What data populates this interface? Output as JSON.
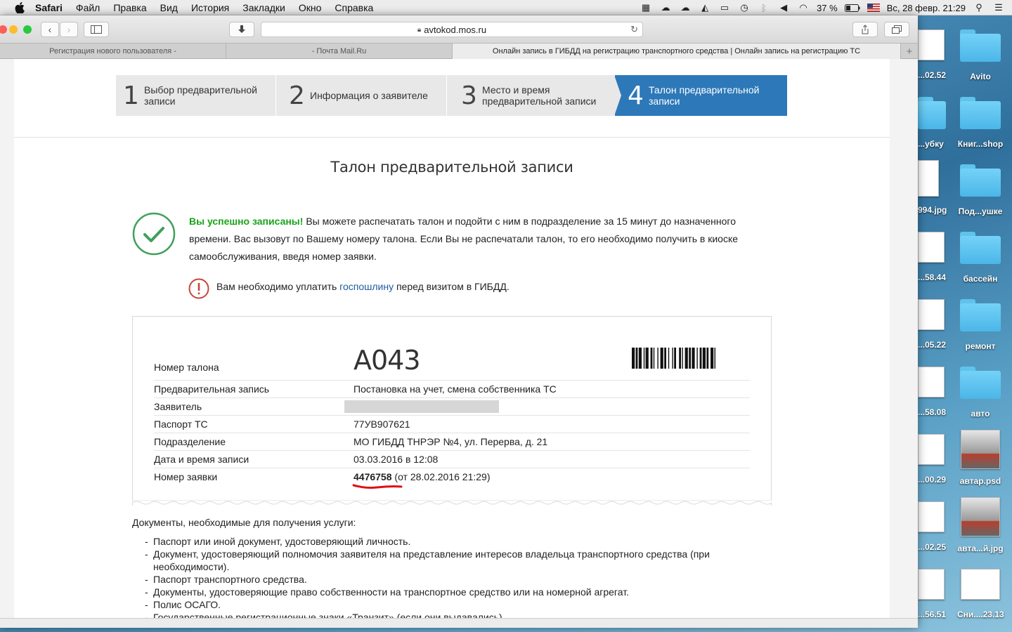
{
  "menubar": {
    "items": [
      "Safari",
      "Файл",
      "Правка",
      "Вид",
      "История",
      "Закладки",
      "Окно",
      "Справка"
    ],
    "battery": "37 %",
    "datetime": "Вс, 28 февр.  21:29"
  },
  "browser": {
    "url": "avtokod.mos.ru",
    "tabs": [
      "Регистрация нового пользователя -",
      "- Почта Mail.Ru",
      "Онлайн запись в ГИБДД на регистрацию транспортного средства | Онлайн запись на регистрацию ТС"
    ]
  },
  "steps": [
    {
      "num": "1",
      "label": "Выбор предварительной записи"
    },
    {
      "num": "2",
      "label": "Информация о заявителе"
    },
    {
      "num": "3",
      "label": "Место и время предварительной записи"
    },
    {
      "num": "4",
      "label": "Талон предварительной записи"
    }
  ],
  "page": {
    "title": "Талон предварительной записи",
    "success_strong": "Вы успешно записаны!",
    "success_text": " Вы можете распечатать талон и подойти с ним в подразделение за 15 минут до назначенного времени. Вас вызовут по Вашему номеру талона. Если Вы не распечатали талон, то его необходимо получить в киоске самообслуживания, введя номер заявки.",
    "warn_before": "Вам необходимо уплатить ",
    "warn_link": "госпошлину",
    "warn_after": " перед визитом в ГИБДД."
  },
  "ticket": {
    "number_label": "Номер талона",
    "number": "А043",
    "rows": [
      {
        "key": "Предварительная запись",
        "value": "Постановка на учет, смена собственника ТС"
      },
      {
        "key": "Заявитель",
        "value": ""
      },
      {
        "key": "Паспорт ТС",
        "value": "77УВ907621"
      },
      {
        "key": "Подразделение",
        "value": "МО ГИБДД ТНРЭР №4, ул. Перерва, д. 21"
      },
      {
        "key": "Дата и время записи",
        "value": "03.03.2016 в 12:08"
      }
    ],
    "request_label": "Номер заявки",
    "request_number": "4476758",
    "request_date": " (от 28.02.2016 21:29)"
  },
  "documents": {
    "title": "Документы, необходимые для получения услуги:",
    "items": [
      "Паспорт или иной документ, удостоверяющий личность.",
      "Документ, удостоверяющий полномочия заявителя на представление интересов владельца транспортного средства (при необходимости).",
      "Паспорт транспортного средства.",
      "Документы, удостоверяющие право собственности на транспортное средство или на номерной агрегат.",
      "Полис ОСАГО.",
      "Государственные регистрационные знаки «Транзит» (если они выдавались)."
    ]
  },
  "desktop": {
    "left_labels": [
      "...02.52",
      "...убку",
      "994.jpg",
      "...58.44",
      "...05.22",
      "...58.08",
      "...00.29",
      "...02.25",
      "...56.51"
    ],
    "right_labels": [
      "Avito",
      "Книг...shop",
      "Под...ушке",
      "бассейн",
      "ремонт",
      "авто",
      "автар.psd",
      "авта...й.jpg",
      "Сни....23.13"
    ]
  },
  "colors": {
    "active_step": "#2d78b8",
    "success_green": "#1aa31a",
    "warning_red": "#c8453a",
    "link_blue": "#1e5aa0"
  }
}
